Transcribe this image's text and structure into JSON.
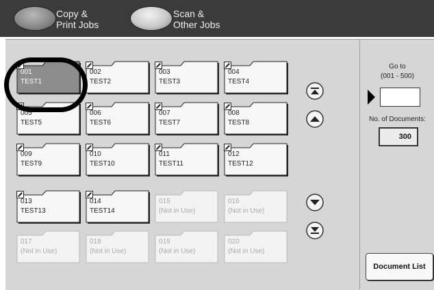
{
  "tabs": [
    {
      "line1": "Copy &",
      "line2": "Print Jobs"
    },
    {
      "line1": "Scan &",
      "line2": "Other Jobs"
    }
  ],
  "folders": [
    {
      "num": "001",
      "name": "TEST1",
      "state": "selected",
      "editable": true
    },
    {
      "num": "002",
      "name": "TEST2",
      "state": "normal",
      "editable": true
    },
    {
      "num": "003",
      "name": "TEST3",
      "state": "normal",
      "editable": true
    },
    {
      "num": "004",
      "name": "TEST4",
      "state": "normal",
      "editable": true
    },
    {
      "num": "005",
      "name": "TEST5",
      "state": "normal",
      "editable": true
    },
    {
      "num": "006",
      "name": "TEST6",
      "state": "normal",
      "editable": true
    },
    {
      "num": "007",
      "name": "TEST7",
      "state": "normal",
      "editable": true
    },
    {
      "num": "008",
      "name": "TEST8",
      "state": "normal",
      "editable": true
    },
    {
      "num": "009",
      "name": "TEST9",
      "state": "normal",
      "editable": true
    },
    {
      "num": "010",
      "name": "TEST10",
      "state": "normal",
      "editable": true
    },
    {
      "num": "011",
      "name": "TEST11",
      "state": "normal",
      "editable": true
    },
    {
      "num": "012",
      "name": "TEST12",
      "state": "normal",
      "editable": true
    },
    {
      "num": "013",
      "name": "TEST13",
      "state": "normal",
      "editable": true
    },
    {
      "num": "014",
      "name": "TEST14",
      "state": "normal",
      "editable": true
    },
    {
      "num": "015",
      "name": "(Not in Use)",
      "state": "unused",
      "editable": false
    },
    {
      "num": "016",
      "name": "(Not in Use)",
      "state": "unused",
      "editable": false
    },
    {
      "num": "017",
      "name": "(Not in Use)",
      "state": "unused",
      "editable": false
    },
    {
      "num": "018",
      "name": "(Not in Use)",
      "state": "unused",
      "editable": false
    },
    {
      "num": "019",
      "name": "(Not in Use)",
      "state": "unused",
      "editable": false
    },
    {
      "num": "020",
      "name": "(Not in Use)",
      "state": "unused",
      "editable": false
    }
  ],
  "goto": {
    "label": "Go to",
    "range": "(001 - 500)",
    "value": ""
  },
  "documents": {
    "label": "No. of Documents:",
    "count": "300"
  },
  "buttons": {
    "document_list": "Document List"
  },
  "icons": {
    "scroll_top": "double-up-arrow-icon",
    "scroll_up": "up-arrow-icon",
    "scroll_down": "down-arrow-icon",
    "scroll_bottom": "double-down-arrow-icon",
    "folder_edit": "pencil-edit-icon"
  }
}
